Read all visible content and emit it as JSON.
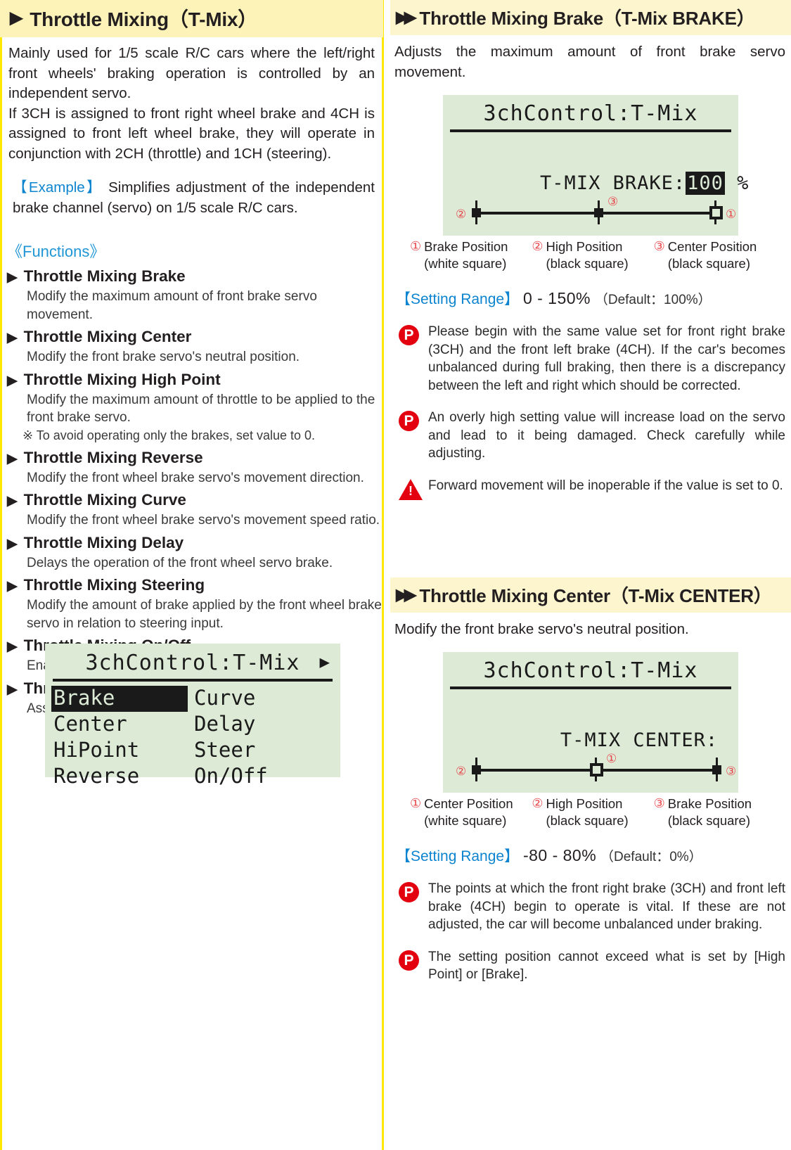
{
  "left": {
    "header": {
      "triangle": "▶",
      "title": "Throttle Mixing（T-Mix）"
    },
    "intro_p1": "Mainly used for 1/5 scale R/C cars where the left/right front wheels' braking operation is controlled by an independent servo.",
    "intro_p2": "If 3CH is assigned to front right wheel brake and 4CH is assigned to front left wheel brake, they will operate in conjunction with 2CH (throttle) and 1CH (steering).",
    "example_tag": "【Example】",
    "example_text": "Simplifies adjustment of the independent brake channel (servo) on 1/5 scale R/C cars.",
    "functions_title": "《Functions》",
    "functions": [
      {
        "name": "Throttle Mixing Brake",
        "desc": "Modify the maximum amount of front brake servo movement."
      },
      {
        "name": "Throttle Mixing Center",
        "desc": "Modify the front brake servo's neutral position."
      },
      {
        "name": "Throttle Mixing High Point",
        "desc": "Modify the maximum amount of throttle to be applied to the front brake servo.",
        "note": "※ To avoid operating only the brakes, set value to 0."
      },
      {
        "name": "Throttle Mixing Reverse",
        "desc": "Modify the front wheel brake servo's movement direction."
      },
      {
        "name": "Throttle Mixing Curve",
        "desc": "Modify the front wheel brake servo's movement speed ratio."
      },
      {
        "name": "Throttle Mixing Delay",
        "desc": "Delays the operation of the front wheel servo brake."
      },
      {
        "name": "Throttle Mixing Steering",
        "desc": "Modify the amount of brake applied by the front wheel brake servo in relation to steering input."
      },
      {
        "name": "Throttle Mixing On/Off",
        "desc": "Enables Throttle Mixing to be activated via ET keys."
      },
      {
        "name": "Throttle Mixing Key",
        "desc": "Assigns ET keys to be used for Throttle Mixing."
      }
    ],
    "lcd_menu": {
      "title": "3chControl:T-Mix",
      "arrow": "▶",
      "items": [
        {
          "label": "Brake",
          "selected": true
        },
        {
          "label": "Curve",
          "selected": false
        },
        {
          "label": "Center",
          "selected": false
        },
        {
          "label": "Delay",
          "selected": false
        },
        {
          "label": "HiPoint",
          "selected": false
        },
        {
          "label": "Steer",
          "selected": false
        },
        {
          "label": "Reverse",
          "selected": false
        },
        {
          "label": "On/Off",
          "selected": false
        }
      ]
    }
  },
  "right": {
    "brake": {
      "header": {
        "triangle": "▶▶",
        "title": "Throttle Mixing Brake（T-Mix BRAKE）"
      },
      "intro": "Adjusts the maximum amount of front brake servo movement.",
      "lcd": {
        "title": "3chControl:T-Mix",
        "label": "T-MIX BRAKE:",
        "value": "100",
        "unit": "%"
      },
      "markers": [
        {
          "id": "②",
          "type": "black",
          "pos": 0,
          "label_side": "left"
        },
        {
          "id": "③",
          "type": "black",
          "pos": 50,
          "label_side": "top"
        },
        {
          "id": "①",
          "type": "white",
          "pos": 100,
          "label_side": "right"
        }
      ],
      "legend": [
        {
          "num": "①",
          "name": "Brake Position",
          "sub": "(white square)"
        },
        {
          "num": "②",
          "name": "High Position",
          "sub": "(black square)"
        },
        {
          "num": "③",
          "name": "Center Position",
          "sub": "(black square)"
        }
      ],
      "range_label": "【Setting Range】",
      "range_value": "0 - 150%",
      "range_default": "（Default：100%）",
      "notices": [
        {
          "icon": "point-icon",
          "text": "Please begin with the same value set for front right brake (3CH) and the front left brake (4CH). If the car's becomes unbalanced during full braking, then there is a discrepancy between the left and right which should be corrected."
        },
        {
          "icon": "point-icon",
          "text": "An overly high setting value will increase load on the servo and lead to it being damaged. Check carefully while adjusting."
        },
        {
          "icon": "warning-icon",
          "text": "Forward movement will be inoperable if the value is set to 0."
        }
      ]
    },
    "center": {
      "header": {
        "triangle": "▶▶",
        "title": "Throttle Mixing Center（T-Mix CENTER）"
      },
      "intro": "Modify the front brake servo's neutral position.",
      "lcd": {
        "title": "3chControl:T-Mix",
        "label": "T-MIX CENTER:",
        "value": "",
        "unit": ""
      },
      "markers": [
        {
          "id": "②",
          "type": "black",
          "pos": 0,
          "label_side": "left"
        },
        {
          "id": "①",
          "type": "white",
          "pos": 50,
          "label_side": "top"
        },
        {
          "id": "③",
          "type": "black",
          "pos": 100,
          "label_side": "right"
        }
      ],
      "legend": [
        {
          "num": "①",
          "name": "Center Position",
          "sub": "(white square)"
        },
        {
          "num": "②",
          "name": "High Position",
          "sub": "(black square)"
        },
        {
          "num": "③",
          "name": "Brake Position",
          "sub": "(black square)"
        }
      ],
      "range_label": "【Setting Range】",
      "range_value": "-80 - 80%",
      "range_default": "（Default：0%）",
      "notices": [
        {
          "icon": "point-icon",
          "text": "The points at which the front right brake (3CH) and front left brake (4CH) begin to operate is vital. If these are not adjusted, the car will become unbalanced under braking."
        },
        {
          "icon": "point-icon",
          "text": "The setting position cannot exceed what is set by [High Point] or [Brake]."
        }
      ]
    }
  },
  "colors": {
    "header_bg": "#fdf3b8",
    "accent_blue": "#0c84cf",
    "accent_red": "#e3000f",
    "lcd_bg": "#dcead6",
    "rule_yellow": "#ffe800"
  }
}
